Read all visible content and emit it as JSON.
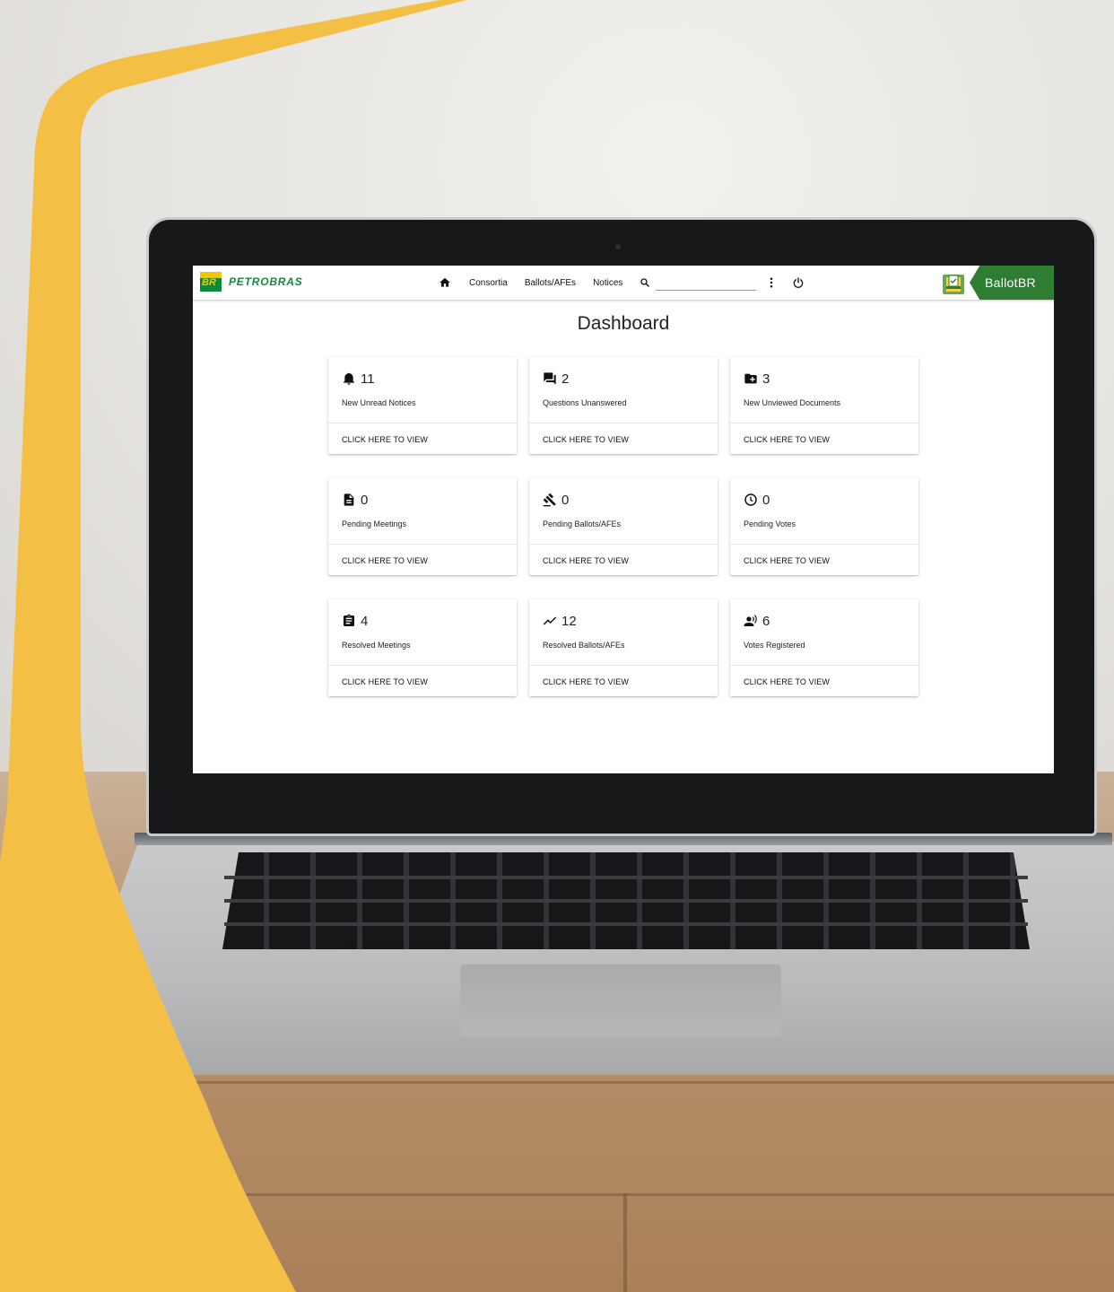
{
  "brand": {
    "logo_text": "BR",
    "name": "PETROBRAS"
  },
  "nav": {
    "items": [
      {
        "label": "Consortia"
      },
      {
        "label": "Ballots/AFEs"
      },
      {
        "label": "Notices"
      }
    ],
    "search": {
      "value": "",
      "placeholder": ""
    }
  },
  "app": {
    "name": "BallotBR"
  },
  "page": {
    "title": "Dashboard"
  },
  "cards": [
    {
      "icon": "bell-icon",
      "count": "11",
      "label": "New Unread Notices",
      "action": "CLICK HERE TO VIEW"
    },
    {
      "icon": "chat-bubbles-icon",
      "count": "2",
      "label": "Questions Unanswered",
      "action": "CLICK HERE TO VIEW"
    },
    {
      "icon": "folder-plus-icon",
      "count": "3",
      "label": "New Unviewed Documents",
      "action": "CLICK HERE TO VIEW"
    },
    {
      "icon": "document-icon",
      "count": "0",
      "label": "Pending Meetings",
      "action": "CLICK HERE TO VIEW"
    },
    {
      "icon": "gavel-icon",
      "count": "0",
      "label": "Pending Ballots/AFEs",
      "action": "CLICK HERE TO VIEW"
    },
    {
      "icon": "clock-icon",
      "count": "0",
      "label": "Pending Votes",
      "action": "CLICK HERE TO VIEW"
    },
    {
      "icon": "clipboard-icon",
      "count": "4",
      "label": "Resolved Meetings",
      "action": "CLICK HERE TO VIEW"
    },
    {
      "icon": "trending-up-icon",
      "count": "12",
      "label": "Resolved Ballots/AFEs",
      "action": "CLICK HERE TO VIEW"
    },
    {
      "icon": "record-voice-icon",
      "count": "6",
      "label": "Votes Registered",
      "action": "CLICK HERE TO VIEW"
    }
  ],
  "colors": {
    "frame_yellow": "#f3bf45",
    "brand_green": "#138a3d",
    "app_badge_green": "#2e7d32",
    "logo_yellow": "#f5c400"
  }
}
